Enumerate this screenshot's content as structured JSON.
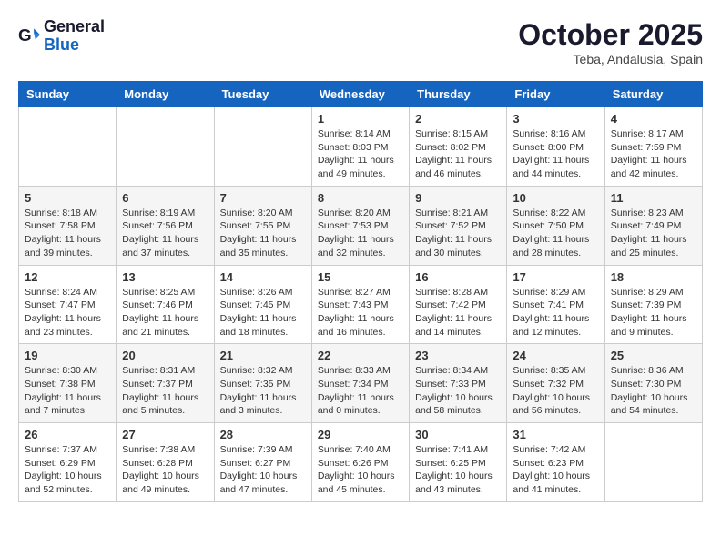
{
  "header": {
    "logo_line1": "General",
    "logo_line2": "Blue",
    "month": "October 2025",
    "location": "Teba, Andalusia, Spain"
  },
  "days_of_week": [
    "Sunday",
    "Monday",
    "Tuesday",
    "Wednesday",
    "Thursday",
    "Friday",
    "Saturday"
  ],
  "weeks": [
    [
      {
        "day": "",
        "info": ""
      },
      {
        "day": "",
        "info": ""
      },
      {
        "day": "",
        "info": ""
      },
      {
        "day": "1",
        "info": "Sunrise: 8:14 AM\nSunset: 8:03 PM\nDaylight: 11 hours\nand 49 minutes."
      },
      {
        "day": "2",
        "info": "Sunrise: 8:15 AM\nSunset: 8:02 PM\nDaylight: 11 hours\nand 46 minutes."
      },
      {
        "day": "3",
        "info": "Sunrise: 8:16 AM\nSunset: 8:00 PM\nDaylight: 11 hours\nand 44 minutes."
      },
      {
        "day": "4",
        "info": "Sunrise: 8:17 AM\nSunset: 7:59 PM\nDaylight: 11 hours\nand 42 minutes."
      }
    ],
    [
      {
        "day": "5",
        "info": "Sunrise: 8:18 AM\nSunset: 7:58 PM\nDaylight: 11 hours\nand 39 minutes."
      },
      {
        "day": "6",
        "info": "Sunrise: 8:19 AM\nSunset: 7:56 PM\nDaylight: 11 hours\nand 37 minutes."
      },
      {
        "day": "7",
        "info": "Sunrise: 8:20 AM\nSunset: 7:55 PM\nDaylight: 11 hours\nand 35 minutes."
      },
      {
        "day": "8",
        "info": "Sunrise: 8:20 AM\nSunset: 7:53 PM\nDaylight: 11 hours\nand 32 minutes."
      },
      {
        "day": "9",
        "info": "Sunrise: 8:21 AM\nSunset: 7:52 PM\nDaylight: 11 hours\nand 30 minutes."
      },
      {
        "day": "10",
        "info": "Sunrise: 8:22 AM\nSunset: 7:50 PM\nDaylight: 11 hours\nand 28 minutes."
      },
      {
        "day": "11",
        "info": "Sunrise: 8:23 AM\nSunset: 7:49 PM\nDaylight: 11 hours\nand 25 minutes."
      }
    ],
    [
      {
        "day": "12",
        "info": "Sunrise: 8:24 AM\nSunset: 7:47 PM\nDaylight: 11 hours\nand 23 minutes."
      },
      {
        "day": "13",
        "info": "Sunrise: 8:25 AM\nSunset: 7:46 PM\nDaylight: 11 hours\nand 21 minutes."
      },
      {
        "day": "14",
        "info": "Sunrise: 8:26 AM\nSunset: 7:45 PM\nDaylight: 11 hours\nand 18 minutes."
      },
      {
        "day": "15",
        "info": "Sunrise: 8:27 AM\nSunset: 7:43 PM\nDaylight: 11 hours\nand 16 minutes."
      },
      {
        "day": "16",
        "info": "Sunrise: 8:28 AM\nSunset: 7:42 PM\nDaylight: 11 hours\nand 14 minutes."
      },
      {
        "day": "17",
        "info": "Sunrise: 8:29 AM\nSunset: 7:41 PM\nDaylight: 11 hours\nand 12 minutes."
      },
      {
        "day": "18",
        "info": "Sunrise: 8:29 AM\nSunset: 7:39 PM\nDaylight: 11 hours\nand 9 minutes."
      }
    ],
    [
      {
        "day": "19",
        "info": "Sunrise: 8:30 AM\nSunset: 7:38 PM\nDaylight: 11 hours\nand 7 minutes."
      },
      {
        "day": "20",
        "info": "Sunrise: 8:31 AM\nSunset: 7:37 PM\nDaylight: 11 hours\nand 5 minutes."
      },
      {
        "day": "21",
        "info": "Sunrise: 8:32 AM\nSunset: 7:35 PM\nDaylight: 11 hours\nand 3 minutes."
      },
      {
        "day": "22",
        "info": "Sunrise: 8:33 AM\nSunset: 7:34 PM\nDaylight: 11 hours\nand 0 minutes."
      },
      {
        "day": "23",
        "info": "Sunrise: 8:34 AM\nSunset: 7:33 PM\nDaylight: 10 hours\nand 58 minutes."
      },
      {
        "day": "24",
        "info": "Sunrise: 8:35 AM\nSunset: 7:32 PM\nDaylight: 10 hours\nand 56 minutes."
      },
      {
        "day": "25",
        "info": "Sunrise: 8:36 AM\nSunset: 7:30 PM\nDaylight: 10 hours\nand 54 minutes."
      }
    ],
    [
      {
        "day": "26",
        "info": "Sunrise: 7:37 AM\nSunset: 6:29 PM\nDaylight: 10 hours\nand 52 minutes."
      },
      {
        "day": "27",
        "info": "Sunrise: 7:38 AM\nSunset: 6:28 PM\nDaylight: 10 hours\nand 49 minutes."
      },
      {
        "day": "28",
        "info": "Sunrise: 7:39 AM\nSunset: 6:27 PM\nDaylight: 10 hours\nand 47 minutes."
      },
      {
        "day": "29",
        "info": "Sunrise: 7:40 AM\nSunset: 6:26 PM\nDaylight: 10 hours\nand 45 minutes."
      },
      {
        "day": "30",
        "info": "Sunrise: 7:41 AM\nSunset: 6:25 PM\nDaylight: 10 hours\nand 43 minutes."
      },
      {
        "day": "31",
        "info": "Sunrise: 7:42 AM\nSunset: 6:23 PM\nDaylight: 10 hours\nand 41 minutes."
      },
      {
        "day": "",
        "info": ""
      }
    ]
  ]
}
